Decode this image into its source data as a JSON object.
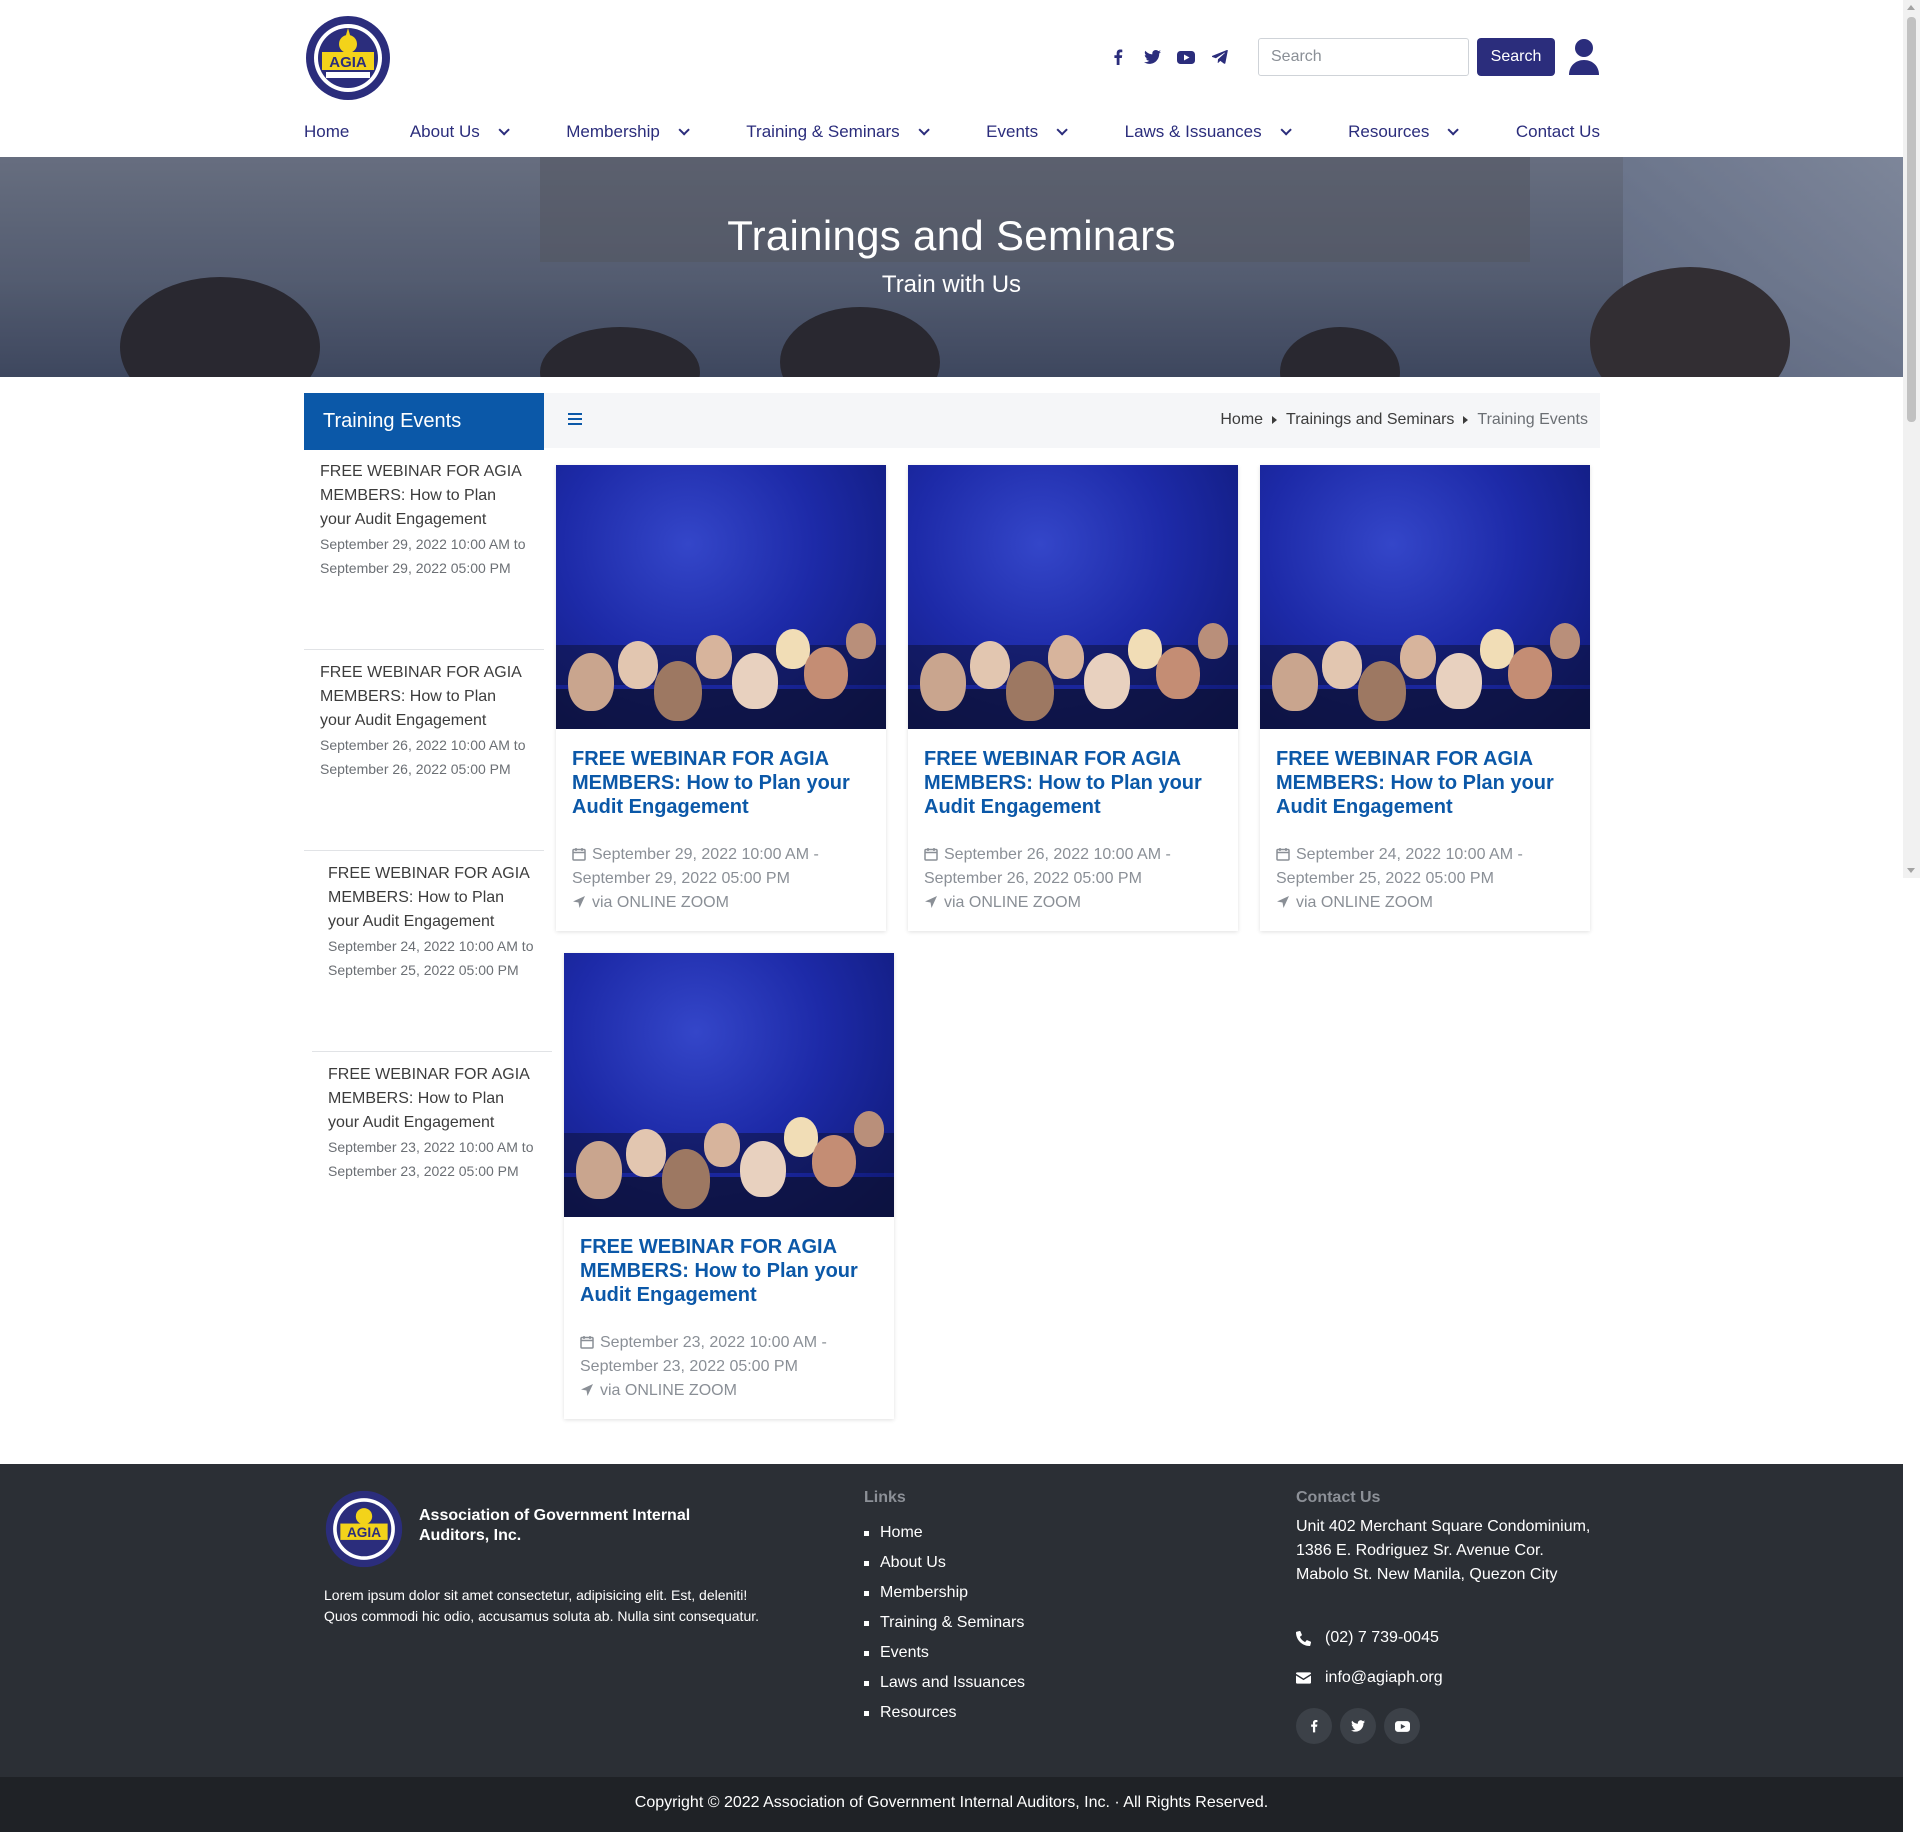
{
  "header": {
    "social": [
      {
        "icon": "facebook-icon"
      },
      {
        "icon": "twitter-icon"
      },
      {
        "icon": "youtube-icon"
      },
      {
        "icon": "telegram-icon"
      }
    ],
    "search_placeholder": "Search",
    "search_button": "Search",
    "brand_color": "#2b2d7c"
  },
  "nav": [
    {
      "label": "Home",
      "dropdown": false
    },
    {
      "label": "About Us",
      "dropdown": true
    },
    {
      "label": "Membership",
      "dropdown": true
    },
    {
      "label": "Training & Seminars",
      "dropdown": true
    },
    {
      "label": "Events",
      "dropdown": true
    },
    {
      "label": "Laws & Issuances",
      "dropdown": true
    },
    {
      "label": "Resources",
      "dropdown": true
    },
    {
      "label": "Contact Us",
      "dropdown": false
    }
  ],
  "hero": {
    "title": "Trainings and Seminars",
    "subtitle": "Train with Us"
  },
  "sidebar": {
    "title": "Training Events",
    "items": [
      {
        "title": "FREE WEBINAR FOR AGIA MEMBERS: How to Plan your Audit Engagement",
        "date": "September 29, 2022 10:00 AM to September 29, 2022 05:00 PM"
      },
      {
        "title": "FREE WEBINAR FOR AGIA MEMBERS: How to Plan your Audit Engagement",
        "date": "September 26, 2022 10:00 AM to September 26, 2022 05:00 PM"
      },
      {
        "title": "FREE WEBINAR FOR AGIA MEMBERS: How to Plan your Audit Engagement",
        "date": "September 24, 2022 10:00 AM to September 25, 2022 05:00 PM"
      },
      {
        "title": "FREE WEBINAR FOR AGIA MEMBERS: How to Plan your Audit Engagement",
        "date": "September 23, 2022 10:00 AM to September 23, 2022 05:00 PM"
      }
    ]
  },
  "breadcrumb": [
    "Home",
    "Trainings and Seminars",
    "Training Events"
  ],
  "cards": [
    {
      "title": "FREE WEBINAR FOR AGIA MEMBERS: How to Plan your Audit Engagement",
      "date": "September 29, 2022 10:00 AM - September 29, 2022 05:00 PM",
      "venue": "via ONLINE ZOOM"
    },
    {
      "title": "FREE WEBINAR FOR AGIA MEMBERS: How to Plan your Audit Engagement",
      "date": "September 26, 2022 10:00 AM - September 26, 2022 05:00 PM",
      "venue": "via ONLINE ZOOM"
    },
    {
      "title": "FREE WEBINAR FOR AGIA MEMBERS: How to Plan your Audit Engagement",
      "date": "September 24, 2022 10:00 AM - September 25, 2022 05:00 PM",
      "venue": "via ONLINE ZOOM"
    },
    {
      "title": "FREE WEBINAR FOR AGIA MEMBERS: How to Plan your Audit Engagement",
      "date": "September 23, 2022 10:00 AM - September 23, 2022 05:00 PM",
      "venue": "via ONLINE ZOOM"
    }
  ],
  "footer": {
    "org_name": "Association of Government Internal Auditors, Inc.",
    "about": "Lorem ipsum dolor sit amet consectetur, adipisicing elit. Est, deleniti! Quos commodi hic odio, accusamus soluta ab. Nulla sint consequatur.",
    "links_heading": "Links",
    "links": [
      "Home",
      "About Us",
      "Membership",
      "Training & Seminars",
      "Events",
      "Laws and Issuances",
      "Resources"
    ],
    "contact_heading": "Contact Us",
    "address": "Unit 402 Merchant Square Condominium, 1386 E. Rodriguez Sr. Avenue Cor. Mabolo St. New Manila, Quezon City",
    "phone": "(02) 7 739-0045",
    "email": "info@agiaph.org",
    "social": [
      {
        "icon": "facebook-icon"
      },
      {
        "icon": "twitter-icon"
      },
      {
        "icon": "youtube-icon"
      }
    ],
    "copyright": "Copyright © 2022 Association of Government Internal Auditors, Inc. · All Rights Reserved."
  }
}
